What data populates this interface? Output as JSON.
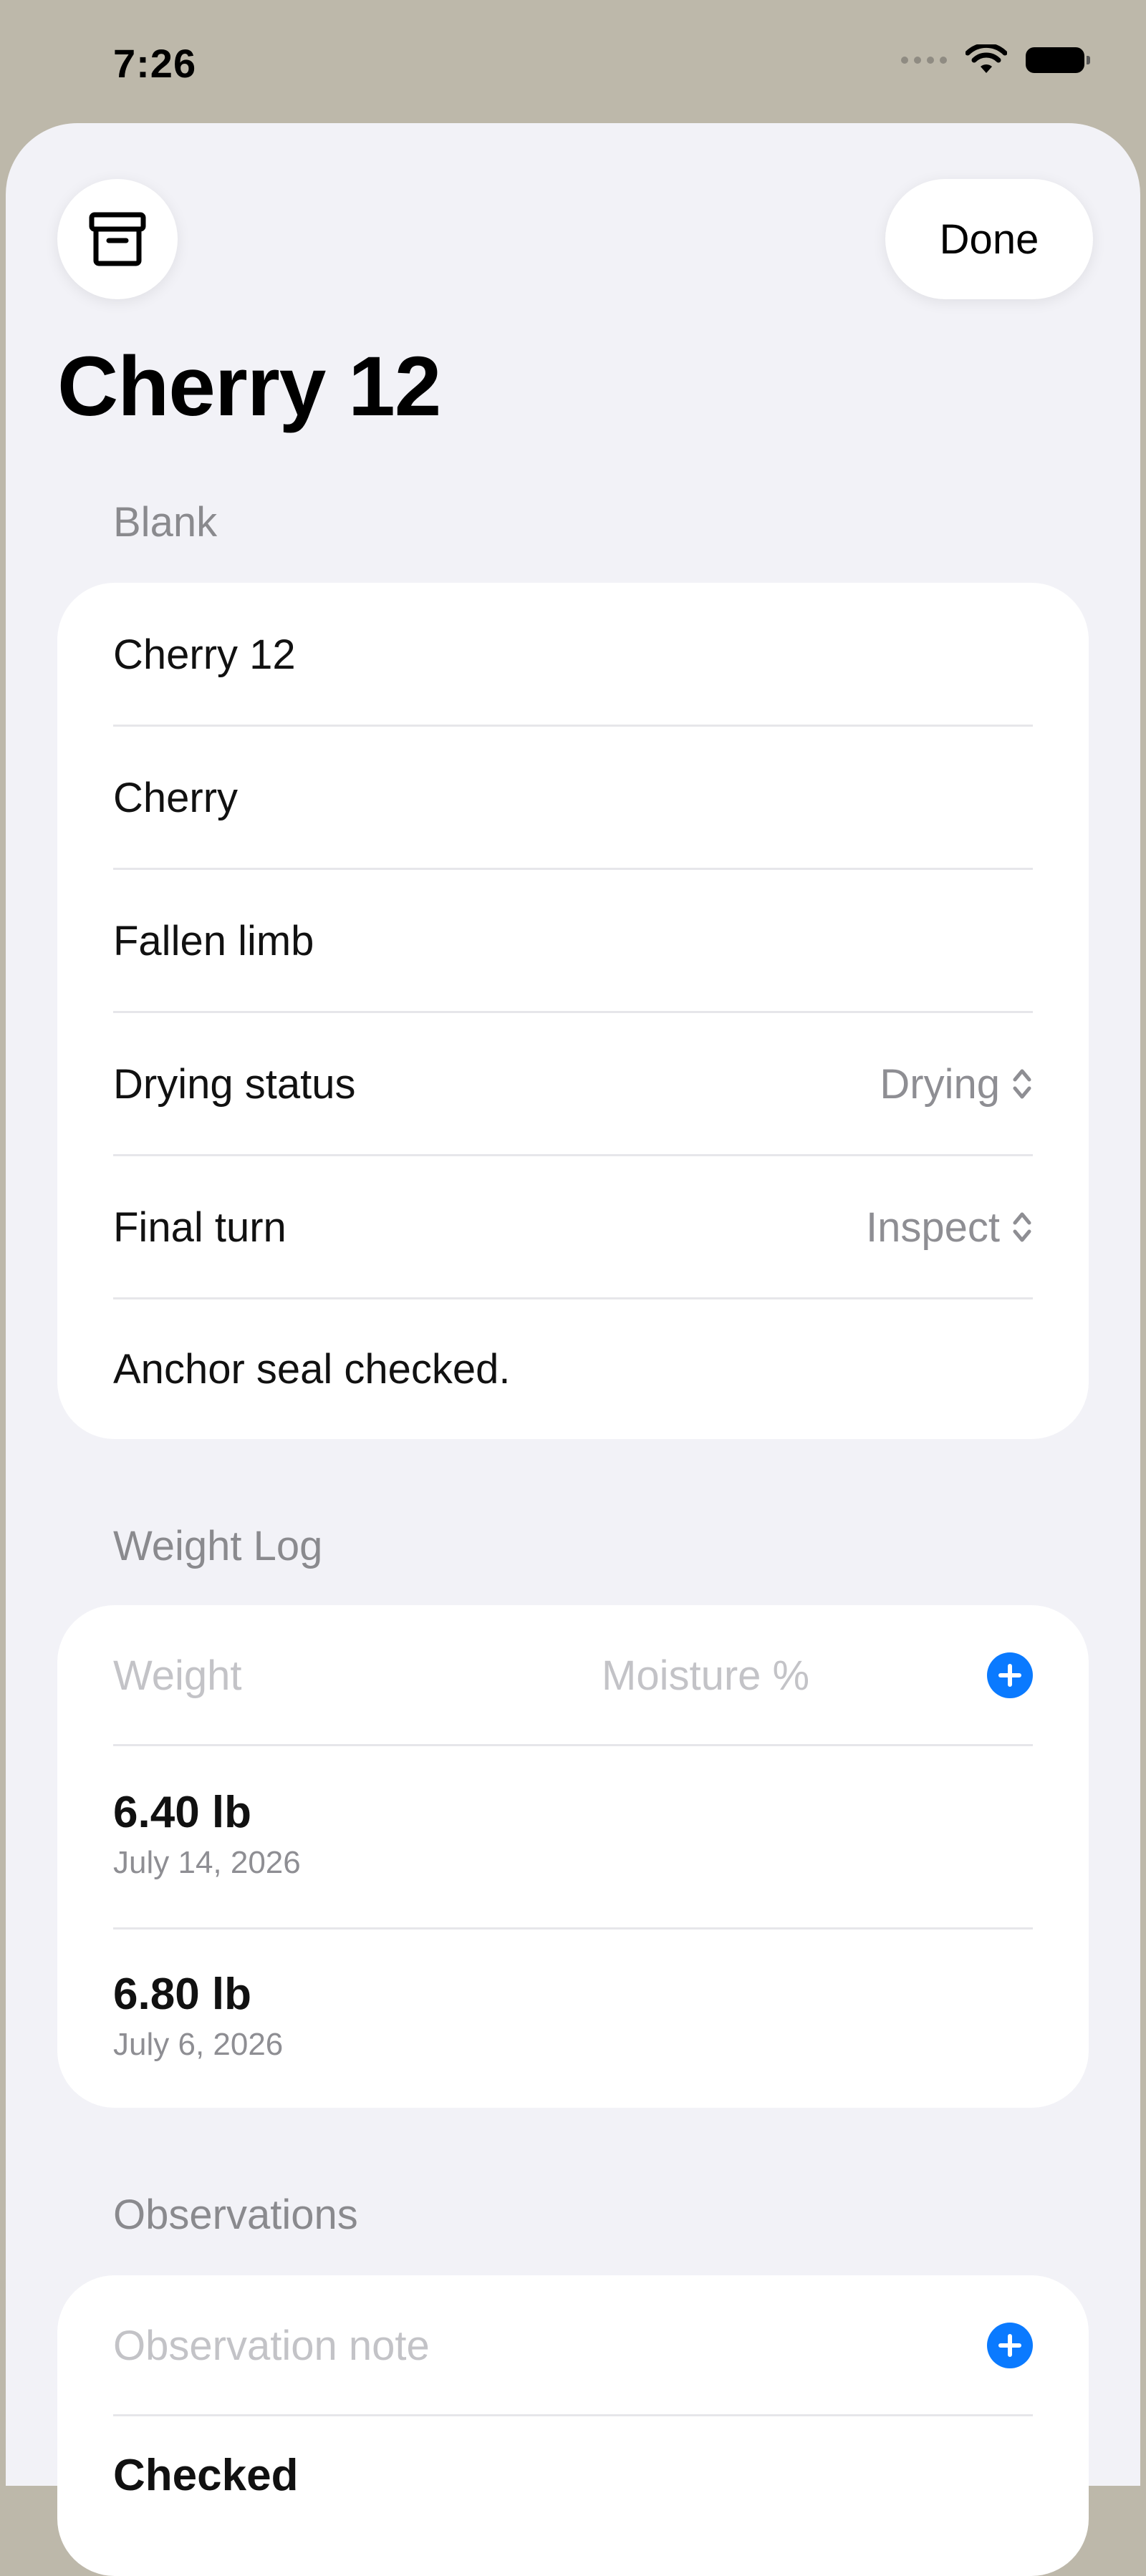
{
  "status_bar": {
    "time": "7:26"
  },
  "toolbar": {
    "done_label": "Done"
  },
  "page": {
    "title": "Cherry 12"
  },
  "blank_section": {
    "header": "Blank",
    "name": "Cherry 12",
    "species": "Cherry",
    "source": "Fallen limb",
    "drying_status_label": "Drying status",
    "drying_status_value": "Drying",
    "final_turn_label": "Final turn",
    "final_turn_value": "Inspect",
    "notes": "Anchor seal checked."
  },
  "weight_log": {
    "header": "Weight Log",
    "weight_placeholder": "Weight",
    "moisture_placeholder": "Moisture %",
    "entries": [
      {
        "weight": "6.40 lb",
        "date": "July 14, 2026"
      },
      {
        "weight": "6.80 lb",
        "date": "July 6, 2026"
      }
    ]
  },
  "observations": {
    "header": "Observations",
    "note_placeholder": "Observation note",
    "partial_entry": "Checked"
  },
  "colors": {
    "accent": "#0a7aff",
    "background": "#f2f2f7",
    "card": "#ffffff"
  },
  "icons": {
    "archive": "archive-box-icon",
    "add": "plus-circle-icon",
    "chevron": "chevron-up-down-icon"
  }
}
